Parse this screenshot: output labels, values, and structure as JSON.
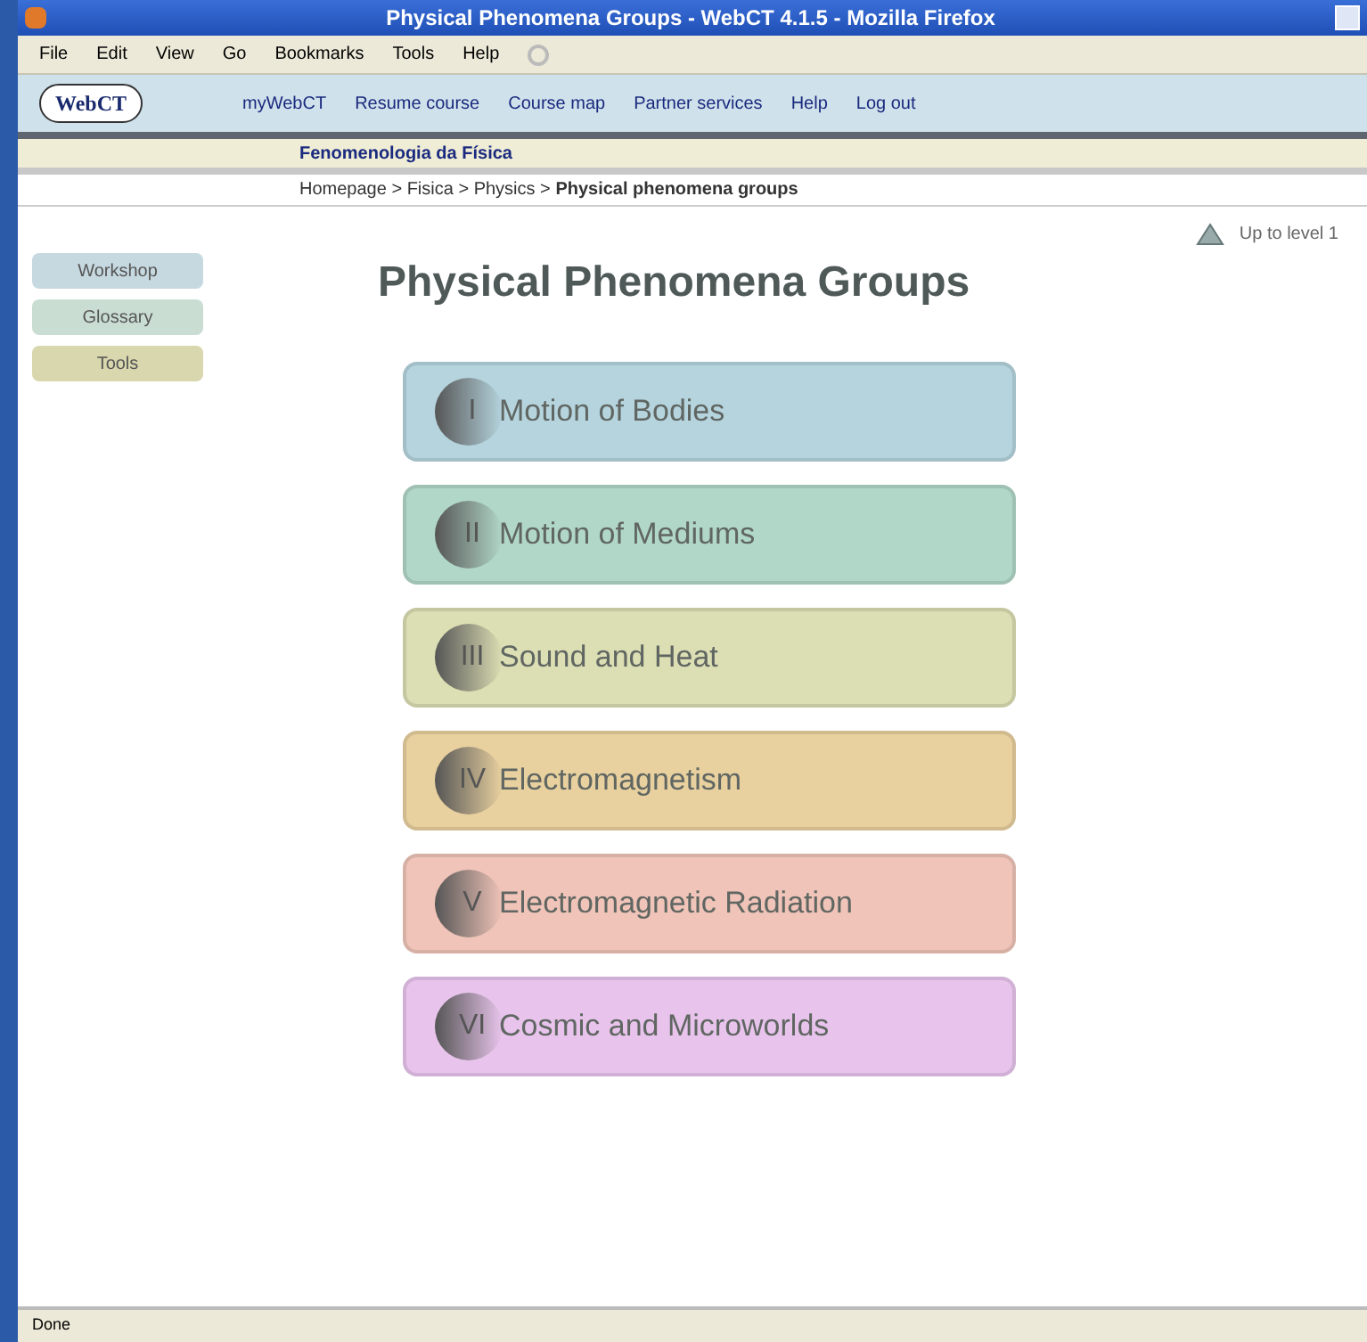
{
  "window": {
    "title": "Physical Phenomena Groups - WebCT 4.1.5 - Mozilla Firefox"
  },
  "menu": [
    "File",
    "Edit",
    "View",
    "Go",
    "Bookmarks",
    "Tools",
    "Help"
  ],
  "webct": {
    "logo": "WebCT",
    "nav": [
      "myWebCT",
      "Resume course",
      "Course map",
      "Partner services",
      "Help",
      "Log out"
    ]
  },
  "course_bar": {
    "title": "Fenomenologia da Física"
  },
  "breadcrumb": {
    "text": "Homepage > Fisica > Physics > **Physical phenomena groups**"
  },
  "up_link": "Up to level 1",
  "sidebar": [
    {
      "label": "Workshop",
      "color": "#c6d9e0"
    },
    {
      "label": "Glossary",
      "color": "#c9ddd3"
    },
    {
      "label": "Tools",
      "color": "#d8d7ad"
    }
  ],
  "heading": "Physical Phenomena Groups",
  "groups": [
    {
      "numeral": "I",
      "label": "Motion of Bodies",
      "color": "#b5d4de"
    },
    {
      "numeral": "II",
      "label": "Motion of Mediums",
      "color": "#b1d7c8"
    },
    {
      "numeral": "III",
      "label": "Sound and Heat",
      "color": "#dcdeb3"
    },
    {
      "numeral": "IV",
      "label": "Electromagnetism",
      "color": "#e8d09f"
    },
    {
      "numeral": "V",
      "label": "Electromagnetic Radiation",
      "color": "#f0c4b8"
    },
    {
      "numeral": "VI",
      "label": "Cosmic and Microworlds",
      "color": "#e8c4ec"
    }
  ],
  "status_bar": {
    "text": "Done"
  }
}
